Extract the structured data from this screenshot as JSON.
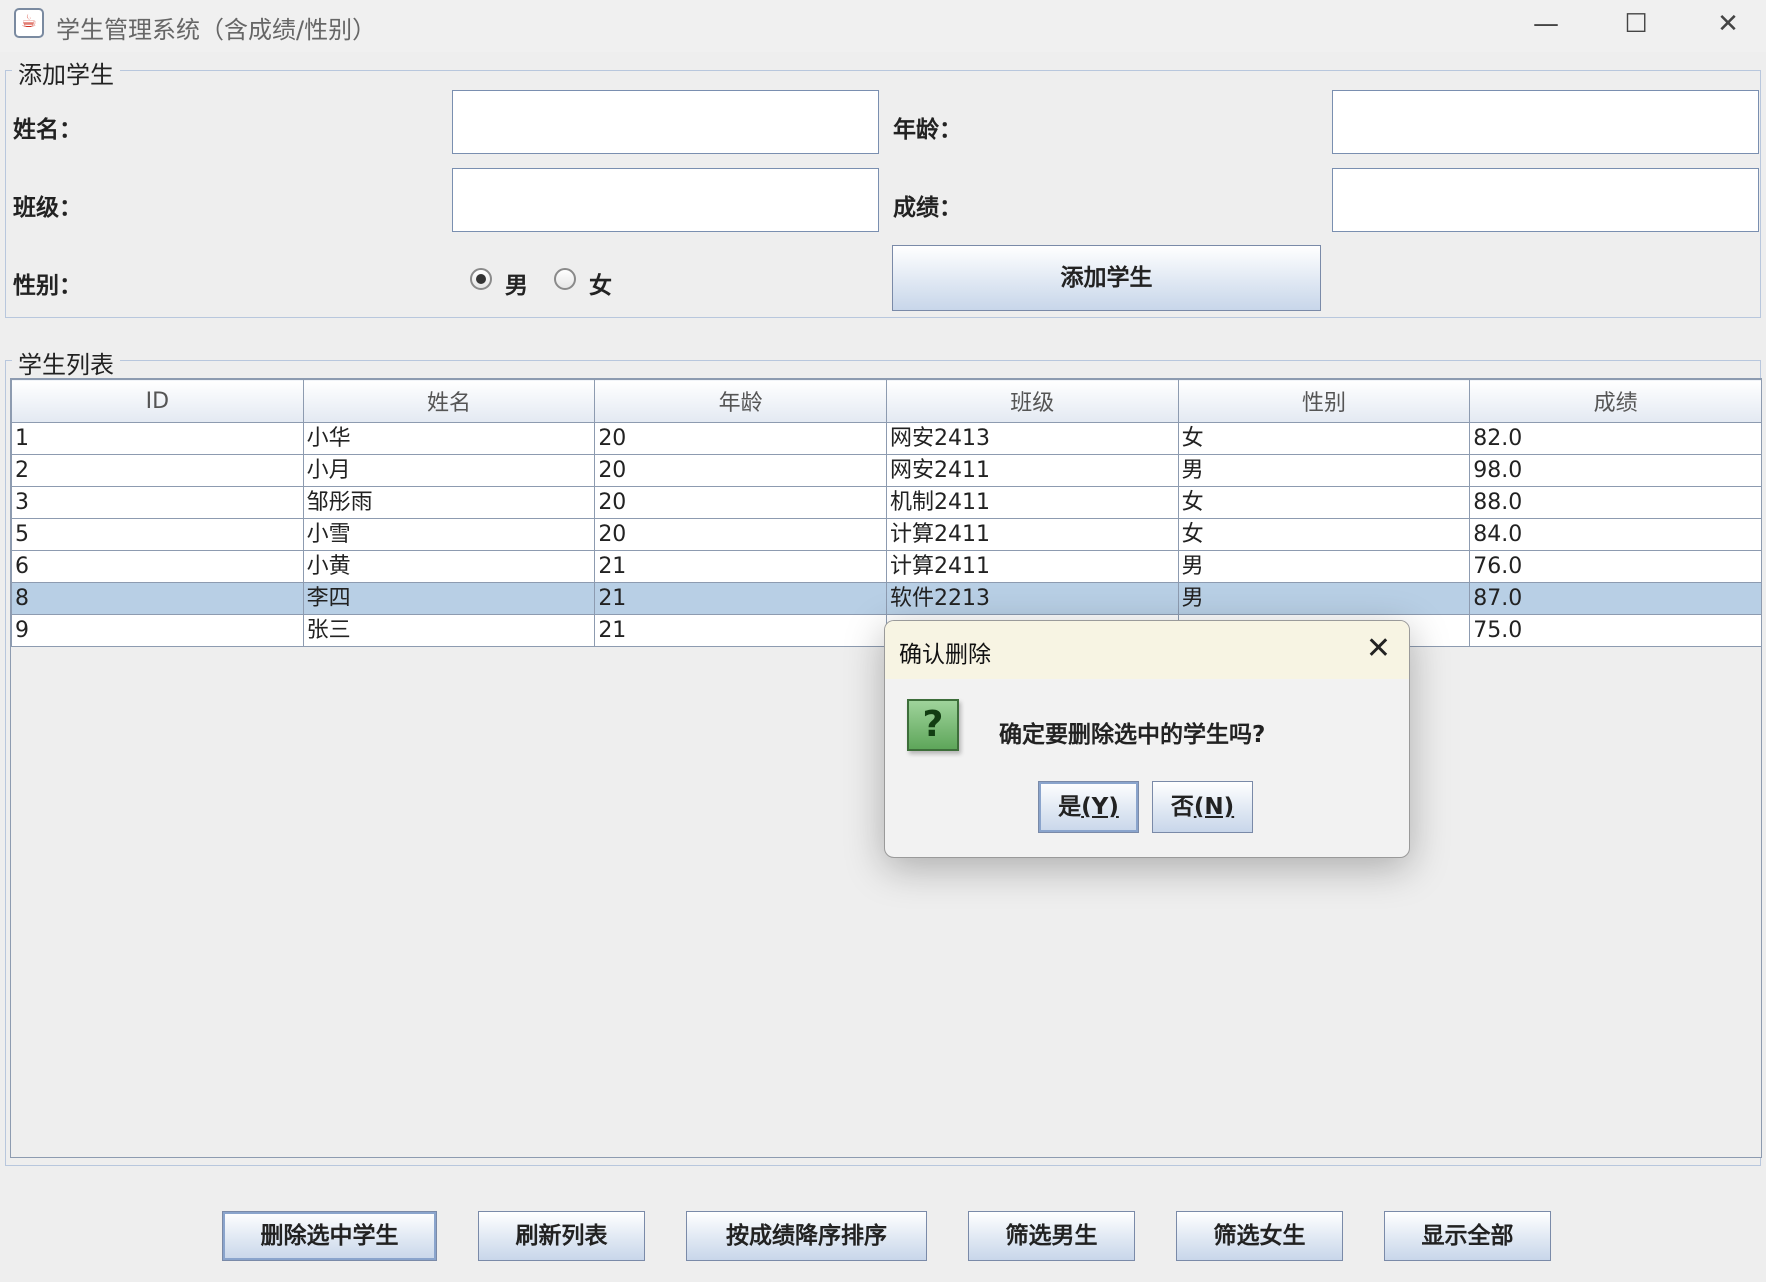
{
  "window": {
    "title": "学生管理系统（含成绩/性别）",
    "controls": {
      "minimize": "—",
      "maximize": "☐",
      "close": "✕"
    }
  },
  "add_section": {
    "legend": "添加学生",
    "name_label": "姓名：",
    "name_value": "",
    "age_label": "年龄：",
    "age_value": "",
    "class_label": "班级：",
    "class_value": "",
    "score_label": "成绩：",
    "score_value": "",
    "gender_label": "性别：",
    "gender_options": [
      "男",
      "女"
    ],
    "gender_selected": "男",
    "add_button": "添加学生"
  },
  "list_section": {
    "legend": "学生列表",
    "columns": [
      "ID",
      "姓名",
      "年龄",
      "班级",
      "性别",
      "成绩"
    ],
    "rows": [
      [
        "1",
        "小华",
        "20",
        "网安2413",
        "女",
        "82.0"
      ],
      [
        "2",
        "小月",
        "20",
        "网安2411",
        "男",
        "98.0"
      ],
      [
        "3",
        "邹彤雨",
        "20",
        "机制2411",
        "女",
        "88.0"
      ],
      [
        "5",
        "小雪",
        "20",
        "计算2411",
        "女",
        "84.0"
      ],
      [
        "6",
        "小黄",
        "21",
        "计算2411",
        "男",
        "76.0"
      ],
      [
        "8",
        "李四",
        "21",
        "软件2213",
        "男",
        "87.0"
      ],
      [
        "9",
        "张三",
        "21",
        "",
        "",
        "75.0"
      ]
    ],
    "selected_row": 5
  },
  "bottom_buttons": [
    "删除选中学生",
    "刷新列表",
    "按成绩降序排序",
    "筛选男生",
    "筛选女生",
    "显示全部"
  ],
  "dialog": {
    "title": "确认删除",
    "close": "✕",
    "icon": "question-icon",
    "icon_glyph": "?",
    "message": "确定要删除选中的学生吗?",
    "yes_text": "是",
    "yes_key": "(Y)",
    "no_text": "否",
    "no_key": "(N)"
  }
}
